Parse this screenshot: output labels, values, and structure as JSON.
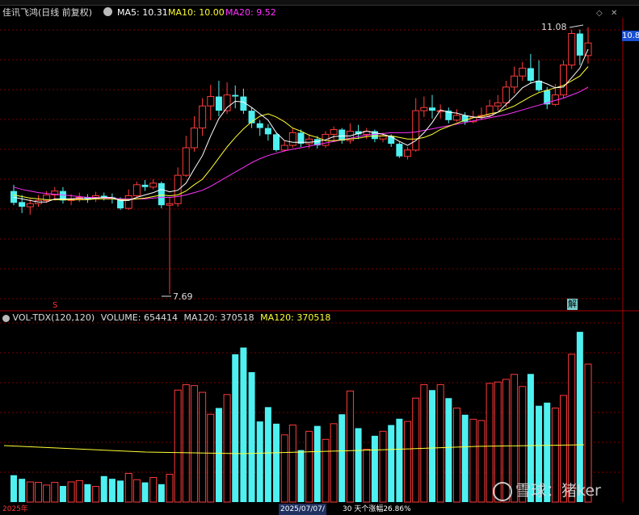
{
  "header": {
    "stock_name": "佳讯飞鸿(日线 前复权)",
    "ma5": "MA5: 10.31",
    "ma10": "MA10: 10.00",
    "ma20": "MA20: 9.52",
    "price_tag": "10.8"
  },
  "volume_header": {
    "indicator": "VOL-TDX(120,120)",
    "volume": "VOLUME: 654414",
    "ma120": "MA120: 370518",
    "ma120b": "MA120: 370518"
  },
  "annotations": {
    "high": "11.08",
    "low": "7.69",
    "marker_s": "S",
    "marker_jie": "解"
  },
  "bottom": {
    "date_left": "2025年",
    "date_mid": "2025/07/07/",
    "range_info": "30 天个涨幅26.86%"
  },
  "watermark": {
    "text": "雪球：猪ker"
  },
  "colors": {
    "up": "#ff3b3b",
    "down": "#4ff0f0",
    "ma5": "#ffffff",
    "ma10": "#ffff33",
    "ma20": "#ff33ff",
    "grid": "#7a0000",
    "bg": "#000000"
  },
  "chart_data": {
    "type": "candlestick",
    "series_ohlc": [
      [
        9.0,
        8.85,
        9.08,
        8.82
      ],
      [
        8.86,
        8.8,
        8.95,
        8.72
      ],
      [
        8.8,
        8.84,
        8.9,
        8.7
      ],
      [
        8.84,
        8.88,
        8.95,
        8.8
      ],
      [
        8.88,
        8.95,
        9.0,
        8.85
      ],
      [
        8.95,
        9.0,
        9.05,
        8.88
      ],
      [
        9.0,
        8.88,
        9.05,
        8.84
      ],
      [
        8.88,
        8.9,
        8.96,
        8.82
      ],
      [
        8.9,
        8.92,
        8.98,
        8.86
      ],
      [
        8.92,
        8.9,
        8.96,
        8.85
      ],
      [
        8.9,
        8.94,
        8.99,
        8.86
      ],
      [
        8.94,
        8.92,
        8.98,
        8.88
      ],
      [
        8.92,
        8.9,
        8.97,
        8.84
      ],
      [
        8.9,
        8.78,
        8.92,
        8.76
      ],
      [
        8.78,
        8.94,
        9.02,
        8.76
      ],
      [
        8.94,
        9.08,
        9.12,
        8.92
      ],
      [
        9.08,
        9.05,
        9.14,
        9.0
      ],
      [
        9.05,
        9.1,
        9.15,
        9.02
      ],
      [
        9.1,
        8.82,
        9.12,
        8.78
      ],
      [
        8.82,
        8.84,
        8.92,
        7.69
      ],
      [
        8.84,
        9.2,
        9.3,
        8.8
      ],
      [
        9.2,
        9.55,
        9.7,
        9.18
      ],
      [
        9.55,
        9.8,
        9.95,
        9.5
      ],
      [
        9.8,
        10.08,
        10.18,
        9.7
      ],
      [
        10.08,
        10.2,
        10.35,
        9.9
      ],
      [
        10.2,
        10.02,
        10.4,
        9.95
      ],
      [
        10.02,
        10.22,
        10.38,
        9.98
      ],
      [
        10.22,
        10.2,
        10.34,
        10.05
      ],
      [
        10.2,
        10.02,
        10.3,
        9.98
      ],
      [
        10.02,
        9.86,
        10.06,
        9.8
      ],
      [
        9.86,
        9.8,
        9.9,
        9.7
      ],
      [
        9.8,
        9.72,
        9.85,
        9.64
      ],
      [
        9.72,
        9.52,
        9.74,
        9.5
      ],
      [
        9.52,
        9.58,
        9.64,
        9.5
      ],
      [
        9.58,
        9.74,
        9.8,
        9.55
      ],
      [
        9.74,
        9.6,
        9.78,
        9.56
      ],
      [
        9.6,
        9.66,
        9.72,
        9.54
      ],
      [
        9.66,
        9.58,
        9.7,
        9.54
      ],
      [
        9.58,
        9.72,
        9.76,
        9.55
      ],
      [
        9.72,
        9.78,
        9.82,
        9.62
      ],
      [
        9.78,
        9.64,
        9.8,
        9.6
      ],
      [
        9.64,
        9.76,
        9.86,
        9.6
      ],
      [
        9.76,
        9.72,
        9.84,
        9.66
      ],
      [
        9.72,
        9.76,
        9.8,
        9.66
      ],
      [
        9.76,
        9.66,
        9.78,
        9.62
      ],
      [
        9.66,
        9.7,
        9.74,
        9.62
      ],
      [
        9.7,
        9.6,
        9.72,
        9.56
      ],
      [
        9.6,
        9.44,
        9.62,
        9.42
      ],
      [
        9.44,
        9.52,
        9.56,
        9.4
      ],
      [
        9.52,
        10.02,
        10.18,
        9.5
      ],
      [
        10.02,
        10.06,
        10.2,
        9.94
      ],
      [
        10.06,
        10.02,
        10.22,
        9.92
      ],
      [
        10.02,
        10.02,
        10.1,
        9.92
      ],
      [
        10.02,
        9.9,
        10.06,
        9.86
      ],
      [
        9.9,
        9.96,
        10.04,
        9.88
      ],
      [
        9.96,
        9.88,
        10.0,
        9.84
      ],
      [
        9.88,
        9.94,
        10.02,
        9.86
      ],
      [
        9.94,
        9.96,
        10.06,
        9.9
      ],
      [
        9.96,
        10.08,
        10.16,
        9.94
      ],
      [
        10.08,
        10.12,
        10.22,
        10.02
      ],
      [
        10.12,
        10.32,
        10.4,
        10.06
      ],
      [
        10.32,
        10.46,
        10.58,
        10.24
      ],
      [
        10.46,
        10.56,
        10.64,
        10.4
      ],
      [
        10.56,
        10.4,
        10.74,
        10.36
      ],
      [
        10.4,
        10.28,
        10.66,
        10.26
      ],
      [
        10.28,
        10.1,
        10.32,
        10.04
      ],
      [
        10.1,
        10.22,
        10.36,
        10.08
      ],
      [
        10.22,
        10.6,
        10.66,
        10.18
      ],
      [
        10.6,
        11.0,
        11.05,
        10.55
      ],
      [
        11.0,
        10.72,
        11.05,
        10.6
      ],
      [
        10.72,
        10.88,
        11.08,
        10.62
      ]
    ],
    "ma5": [
      8.92,
      8.9,
      8.88,
      8.86,
      8.86,
      8.9,
      8.9,
      8.9,
      8.91,
      8.9,
      8.91,
      8.92,
      8.92,
      8.88,
      8.88,
      8.92,
      8.95,
      8.98,
      9.02,
      8.99,
      9.01,
      9.1,
      9.28,
      9.45,
      9.7,
      9.92,
      10.06,
      10.14,
      10.13,
      10.06,
      9.98,
      9.9,
      9.74,
      9.64,
      9.62,
      9.62,
      9.62,
      9.63,
      9.65,
      9.69,
      9.7,
      9.7,
      9.73,
      9.76,
      9.74,
      9.72,
      9.69,
      9.63,
      9.58,
      9.64,
      9.74,
      9.87,
      10.03,
      10.0,
      9.99,
      9.96,
      9.94,
      9.93,
      9.95,
      10.0,
      10.1,
      10.2,
      10.31,
      10.37,
      10.4,
      10.36,
      10.31,
      10.32,
      10.44,
      10.56,
      10.8
    ],
    "ma10": [
      8.95,
      8.93,
      8.91,
      8.9,
      8.89,
      8.89,
      8.89,
      8.89,
      8.89,
      8.89,
      8.9,
      8.9,
      8.9,
      8.89,
      8.89,
      8.9,
      8.91,
      8.93,
      8.95,
      8.94,
      8.95,
      9.0,
      9.08,
      9.15,
      9.28,
      9.42,
      9.56,
      9.68,
      9.79,
      9.88,
      9.95,
      9.98,
      9.94,
      9.88,
      9.8,
      9.76,
      9.71,
      9.68,
      9.64,
      9.64,
      9.65,
      9.66,
      9.67,
      9.69,
      9.7,
      9.7,
      9.7,
      9.68,
      9.66,
      9.66,
      9.68,
      9.72,
      9.78,
      9.82,
      9.86,
      9.9,
      9.93,
      9.95,
      9.98,
      10.0,
      10.04,
      10.08,
      10.14,
      10.2,
      10.25,
      10.28,
      10.31,
      10.34,
      10.4,
      10.46,
      10.58
    ],
    "ma20": [
      9.05,
      9.02,
      9.0,
      8.98,
      8.97,
      8.96,
      8.95,
      8.94,
      8.93,
      8.92,
      8.92,
      8.91,
      8.91,
      8.9,
      8.9,
      8.9,
      8.9,
      8.91,
      8.92,
      8.92,
      8.93,
      8.95,
      8.98,
      9.01,
      9.06,
      9.12,
      9.18,
      9.24,
      9.3,
      9.36,
      9.41,
      9.45,
      9.48,
      9.51,
      9.53,
      9.55,
      9.57,
      9.59,
      9.61,
      9.63,
      9.65,
      9.67,
      9.69,
      9.71,
      9.72,
      9.73,
      9.74,
      9.74,
      9.74,
      9.75,
      9.77,
      9.79,
      9.81,
      9.83,
      9.85,
      9.87,
      9.89,
      9.91,
      9.93,
      9.95,
      9.97,
      10.0,
      10.03,
      10.06,
      10.09,
      10.12,
      10.15,
      10.18,
      10.22,
      10.26,
      10.32
    ],
    "volume": [
      60,
      52,
      45,
      44,
      38,
      44,
      36,
      45,
      48,
      40,
      35,
      58,
      52,
      48,
      64,
      50,
      44,
      55,
      40,
      62,
      250,
      262,
      260,
      245,
      196,
      210,
      240,
      330,
      345,
      290,
      180,
      212,
      175,
      150,
      172,
      116,
      158,
      170,
      140,
      175,
      196,
      248,
      165,
      118,
      148,
      158,
      172,
      186,
      180,
      232,
      262,
      250,
      262,
      232,
      210,
      195,
      185,
      182,
      265,
      268,
      274,
      285,
      258,
      286,
      215,
      222,
      210,
      238,
      330,
      380,
      308
    ]
  }
}
